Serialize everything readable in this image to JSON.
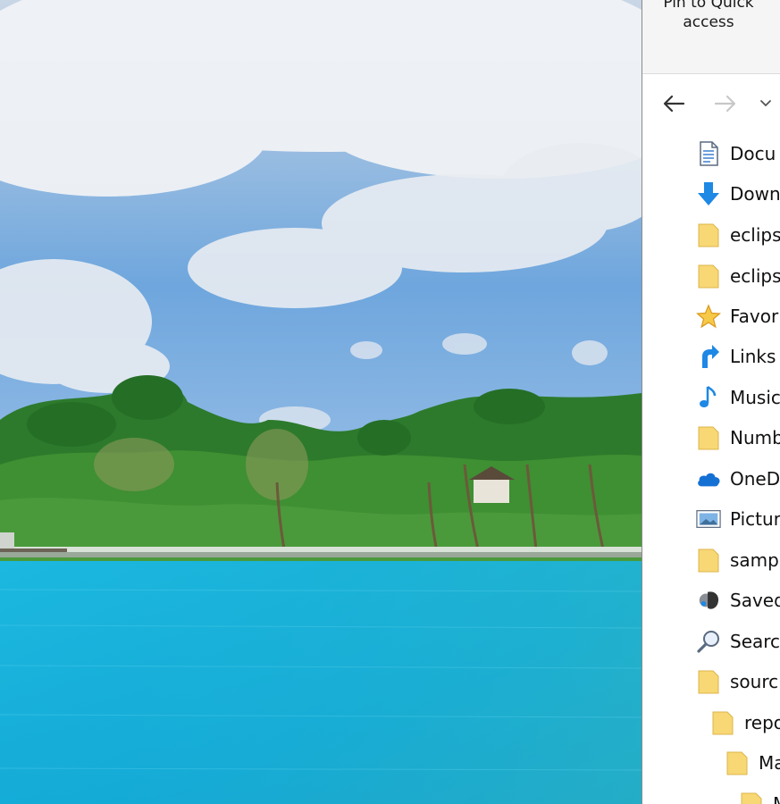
{
  "ribbon": {
    "pin_label": "Pin to Quick\naccess"
  },
  "nav": {
    "back_icon": "arrow-left-icon",
    "forward_icon": "arrow-right-icon",
    "recent_icon": "chevron-down-icon"
  },
  "tree": {
    "items": [
      {
        "label": "Docu",
        "icon": "document-icon"
      },
      {
        "label": "Down",
        "icon": "download-icon"
      },
      {
        "label": "eclips",
        "icon": "folder-icon"
      },
      {
        "label": "eclips",
        "icon": "folder-icon"
      },
      {
        "label": "Favor",
        "icon": "star-icon"
      },
      {
        "label": "Links",
        "icon": "link-icon"
      },
      {
        "label": "Music",
        "icon": "music-icon"
      },
      {
        "label": "Numb",
        "icon": "folder-icon"
      },
      {
        "label": "OneD",
        "icon": "cloud-icon"
      },
      {
        "label": "Pictur",
        "icon": "picture-icon"
      },
      {
        "label": "samp",
        "icon": "folder-icon"
      },
      {
        "label": "Saved",
        "icon": "saved-games-icon"
      },
      {
        "label": "Searc",
        "icon": "search-icon"
      },
      {
        "label": "sourc",
        "icon": "folder-icon"
      },
      {
        "label": "repo",
        "icon": "folder-icon"
      },
      {
        "label": "Ma",
        "icon": "folder-icon"
      },
      {
        "label": "M",
        "icon": "folder-icon"
      }
    ]
  },
  "colors": {
    "folder": "#f8d775",
    "accent_blue": "#1e88e5",
    "ribbon_bg": "#f5f5f5"
  }
}
